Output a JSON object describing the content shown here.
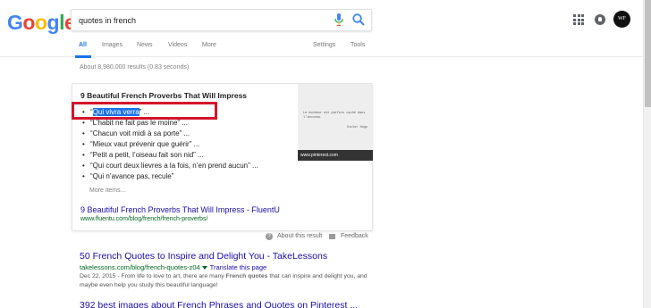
{
  "logo": {
    "letters": [
      "G",
      "o",
      "o",
      "g",
      "l",
      "e"
    ],
    "colors": [
      "#4285f4",
      "#ea4335",
      "#fbbc05",
      "#4285f4",
      "#34a853",
      "#ea4335"
    ]
  },
  "search": {
    "query": "quotes in french"
  },
  "header": {
    "avatar_initials": "WF"
  },
  "tabs": [
    {
      "label": "All"
    },
    {
      "label": "Images"
    },
    {
      "label": "News"
    },
    {
      "label": "Videos"
    },
    {
      "label": "More"
    },
    {
      "label": "Settings"
    },
    {
      "label": "Tools"
    }
  ],
  "stats": "About 8,980,000 results (0.83 seconds)",
  "featured": {
    "title": "9 Beautiful French Proverbs That Will Impress",
    "items": [
      {
        "pre": "“",
        "highlight": "Qui vivra verra",
        "post": "” ..."
      },
      {
        "pre": "“L’habit ne fait pas le moine” ...",
        "highlight": "",
        "post": ""
      },
      {
        "pre": "“Chacun voit midi à sa porte” ...",
        "highlight": "",
        "post": ""
      },
      {
        "pre": "“Mieux vaut prévenir que guérir” ...",
        "highlight": "",
        "post": ""
      },
      {
        "pre": "“Petit a petit, l’oiseau fait son nid” ...",
        "highlight": "",
        "post": ""
      },
      {
        "pre": "“Qui court deux lievres a la fois, n’en prend aucun” ...",
        "highlight": "",
        "post": ""
      },
      {
        "pre": "“Qui n’avance pas, recule”",
        "highlight": "",
        "post": ""
      }
    ],
    "more_items": "More items...",
    "link": "9 Beautiful French Proverbs That Will Impress - FluentU",
    "url": "www.fluentu.com/blog/french/french-proverbs/",
    "image_text": "Le bonheur est parfois caché dans l'inconnu.",
    "image_author": "Victor Hugo",
    "image_source": "www.pinterest.com",
    "about_label": "About this result",
    "feedback_label": "Feedback"
  },
  "results": [
    {
      "title": "50 French Quotes to Inspire and Delight You - TakeLessons",
      "url": "takelessons.com/blog/french-quotes-z04",
      "translate": "Translate this page",
      "snippet_date": "Dec 22, 2015 - ",
      "snippet_a": "From life to love to art, there are many ",
      "snippet_bold": "French quotes",
      "snippet_b": " that can inspire and delight you, and maybe even help you study this beautiful language!"
    },
    {
      "title": "392 best images about French Phrases and Quotes on Pinterest ..."
    }
  ]
}
